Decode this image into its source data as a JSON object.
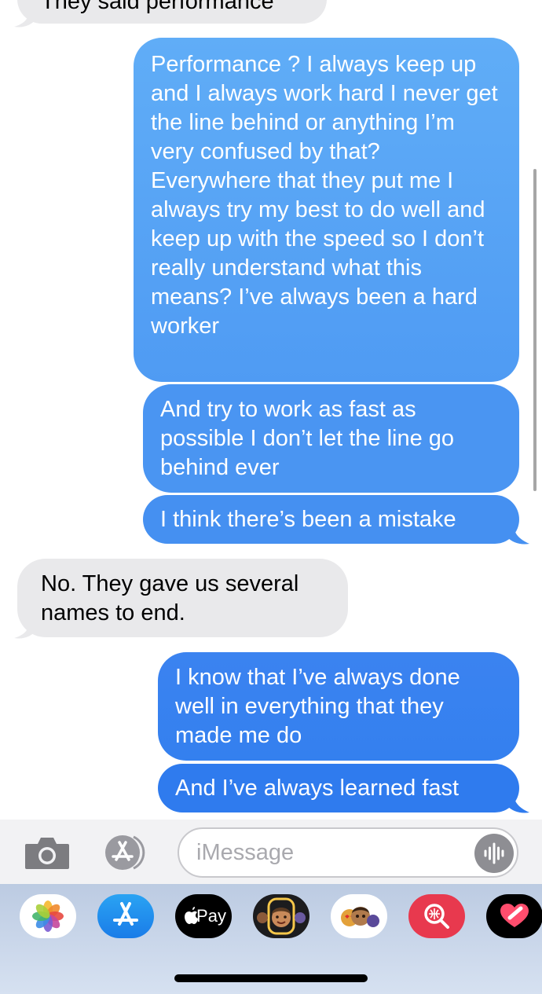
{
  "conversation": {
    "messages": [
      {
        "from": "them",
        "text": "They said performance"
      },
      {
        "from": "me",
        "text": "Performance ? I always keep up and I always work hard I never get the line behind or anything I’m very confused by that? Everywhere that they put me I always try my best to do well and keep up with the speed so I don’t really understand what this means? I’ve always been a hard worker"
      },
      {
        "from": "me",
        "text": "And try to work as fast as possible I don’t let the line go behind ever"
      },
      {
        "from": "me",
        "text": "I think there’s been a mistake"
      },
      {
        "from": "them",
        "text": "No. They gave us several names to end."
      },
      {
        "from": "me",
        "text": "I know that I’ve always done well in everything that they made me do"
      },
      {
        "from": "me",
        "text": "And I’ve always learned fast"
      }
    ]
  },
  "compose": {
    "placeholder": "iMessage",
    "camera_icon": "camera-icon",
    "apps_icon": "app-store-icon",
    "audio_icon": "audio-waveform-icon"
  },
  "app_drawer": {
    "apps": [
      {
        "name": "photos-icon"
      },
      {
        "name": "app-store-icon"
      },
      {
        "name": "apple-pay-icon",
        "label": "Pay"
      },
      {
        "name": "memoji-icon"
      },
      {
        "name": "memoji-stickers-icon"
      },
      {
        "name": "image-search-icon"
      },
      {
        "name": "digital-touch-icon"
      }
    ]
  },
  "colors": {
    "received_bubble": "#e9e9eb",
    "sent_bubble_top": "#60adf7",
    "sent_bubble_bottom": "#2f7bee",
    "drawer_background": "#c9d6ea"
  }
}
